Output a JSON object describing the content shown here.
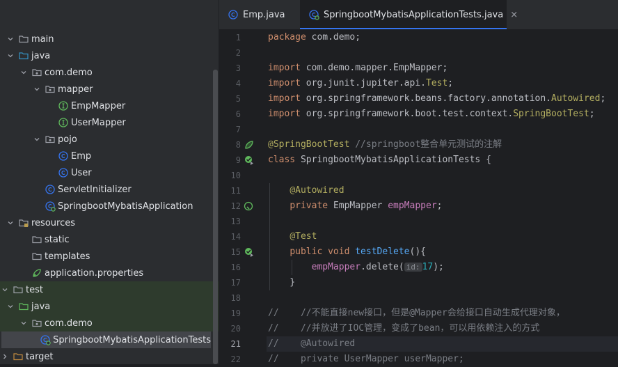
{
  "tree": [
    {
      "label": "main",
      "depth": 0,
      "arrow": "down",
      "icon": "folder"
    },
    {
      "label": "java",
      "depth": 0,
      "arrow": "down",
      "icon": "folder-blue"
    },
    {
      "label": "com.demo",
      "depth": 1,
      "arrow": "down",
      "icon": "package"
    },
    {
      "label": "mapper",
      "depth": 2,
      "arrow": "down",
      "icon": "package"
    },
    {
      "label": "EmpMapper",
      "depth": 3,
      "arrow": "",
      "icon": "interface"
    },
    {
      "label": "UserMapper",
      "depth": 3,
      "arrow": "",
      "icon": "interface"
    },
    {
      "label": "pojo",
      "depth": 2,
      "arrow": "down",
      "icon": "package"
    },
    {
      "label": "Emp",
      "depth": 3,
      "arrow": "",
      "icon": "class"
    },
    {
      "label": "User",
      "depth": 3,
      "arrow": "",
      "icon": "class"
    },
    {
      "label": "ServletInitializer",
      "depth": 2,
      "arrow": "",
      "icon": "class"
    },
    {
      "label": "SpringbootMybatisApplication",
      "depth": 2,
      "arrow": "",
      "icon": "spring-class"
    },
    {
      "label": "resources",
      "depth": 0,
      "arrow": "down",
      "icon": "folder-res"
    },
    {
      "label": "static",
      "depth": 1,
      "arrow": "",
      "icon": "folder"
    },
    {
      "label": "templates",
      "depth": 1,
      "arrow": "",
      "icon": "folder"
    },
    {
      "label": "application.properties",
      "depth": 1,
      "arrow": "",
      "icon": "properties"
    },
    {
      "label": "test",
      "depth": -1,
      "arrow": "down",
      "icon": "folder"
    },
    {
      "label": "java",
      "depth": 0,
      "arrow": "down",
      "icon": "folder-green"
    },
    {
      "label": "com.demo",
      "depth": 1,
      "arrow": "down",
      "icon": "package"
    },
    {
      "label": "SpringbootMybatisApplicationTests",
      "depth": 2,
      "arrow": "",
      "icon": "spring-class",
      "selected": true
    },
    {
      "label": "target",
      "depth": -1,
      "arrow": "right",
      "icon": "folder-target"
    }
  ],
  "tabs": [
    {
      "label": "Emp.java",
      "icon": "class",
      "active": false
    },
    {
      "label": "SpringbootMybatisApplicationTests.java",
      "icon": "spring-class",
      "active": true,
      "close": "×"
    }
  ],
  "editor": {
    "current_line": 21,
    "lines": [
      {
        "n": 1,
        "tokens": [
          [
            "kw",
            "package "
          ],
          [
            "",
            "com.demo;"
          ]
        ]
      },
      {
        "n": 2,
        "tokens": []
      },
      {
        "n": 3,
        "tokens": [
          [
            "kw",
            "import "
          ],
          [
            "",
            "com.demo.mapper.EmpMapper;"
          ]
        ]
      },
      {
        "n": 4,
        "tokens": [
          [
            "kw",
            "import "
          ],
          [
            "",
            "org.junit.jupiter.api."
          ],
          [
            "ann",
            "Test"
          ],
          [
            "",
            ";"
          ]
        ]
      },
      {
        "n": 5,
        "tokens": [
          [
            "kw",
            "import "
          ],
          [
            "",
            "org.springframework.beans.factory.annotation."
          ],
          [
            "ann",
            "Autowired"
          ],
          [
            "",
            ";"
          ]
        ]
      },
      {
        "n": 6,
        "tokens": [
          [
            "kw",
            "import "
          ],
          [
            "",
            "org.springframework.boot.test.context."
          ],
          [
            "ann",
            "SpringBootTest"
          ],
          [
            "",
            ";"
          ]
        ]
      },
      {
        "n": 7,
        "tokens": []
      },
      {
        "n": 8,
        "tokens": [
          [
            "ann",
            "@SpringBootTest"
          ],
          [
            "",
            " "
          ],
          [
            "cm",
            "//springboot整合单元测试的注解"
          ]
        ],
        "gutter": "spring-bean"
      },
      {
        "n": 9,
        "tokens": [
          [
            "kw",
            "class "
          ],
          [
            "",
            "SpringbootMybatisApplicationTests {"
          ]
        ],
        "gutter": "run-test"
      },
      {
        "n": 10,
        "tokens": []
      },
      {
        "n": 11,
        "tokens": [
          [
            "",
            "    "
          ],
          [
            "ann",
            "@Autowired"
          ]
        ]
      },
      {
        "n": 12,
        "tokens": [
          [
            "",
            "    "
          ],
          [
            "kw",
            "private "
          ],
          [
            "",
            "EmpMapper "
          ],
          [
            "fld",
            "empMapper"
          ],
          [
            "",
            ";"
          ]
        ],
        "gutter": "autowired-bean"
      },
      {
        "n": 13,
        "tokens": []
      },
      {
        "n": 14,
        "tokens": [
          [
            "",
            "    "
          ],
          [
            "ann",
            "@Test"
          ]
        ]
      },
      {
        "n": 15,
        "tokens": [
          [
            "",
            "    "
          ],
          [
            "kw",
            "public void "
          ],
          [
            "fn",
            "testDelete"
          ],
          [
            "",
            "(){"
          ]
        ],
        "gutter": "run-test"
      },
      {
        "n": 16,
        "tokens": [
          [
            "",
            "        "
          ],
          [
            "fld",
            "empMapper"
          ],
          [
            "",
            ".delete("
          ],
          [
            "hint",
            "id:"
          ],
          [
            "num",
            "17"
          ],
          [
            "",
            ");"
          ]
        ]
      },
      {
        "n": 17,
        "tokens": [
          [
            "",
            "    }"
          ]
        ]
      },
      {
        "n": 18,
        "tokens": []
      },
      {
        "n": 19,
        "tokens": [
          [
            "cm",
            "//    //不能直接new接口，但是@Mapper会给接口自动生成代理对象，"
          ]
        ]
      },
      {
        "n": 20,
        "tokens": [
          [
            "cm",
            "//    //并放进了IOC管理，变成了bean，可以用依赖注入的方式"
          ]
        ]
      },
      {
        "n": 21,
        "tokens": [
          [
            "cm",
            "//    @Autowired"
          ]
        ]
      },
      {
        "n": 22,
        "tokens": [
          [
            "cm",
            "//    private UserMapper userMapper;"
          ]
        ]
      }
    ]
  },
  "colors": {
    "accent": "#3574f0",
    "folder": "#9da0a8",
    "blue_folder": "#3592c4",
    "green_folder": "#5fb85c",
    "class": "#3574f0",
    "interface": "#5fb85c",
    "spring": "#5fb85c"
  }
}
